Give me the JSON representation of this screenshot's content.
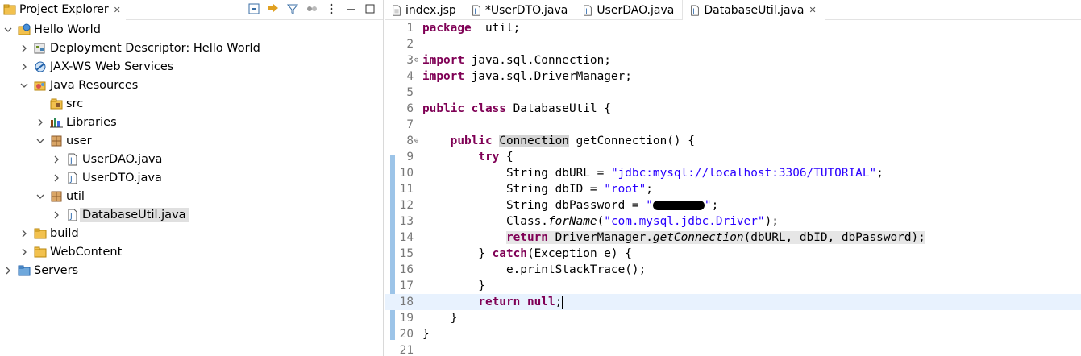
{
  "explorer": {
    "title": "Project Explorer",
    "tree": [
      {
        "label": "Hello World",
        "depth": 0,
        "twisty": "expanded",
        "icon": "web-project-icon"
      },
      {
        "label": "Deployment Descriptor: Hello World",
        "depth": 1,
        "twisty": "collapsed",
        "icon": "deployment-descriptor-icon"
      },
      {
        "label": "JAX-WS Web Services",
        "depth": 1,
        "twisty": "collapsed",
        "icon": "web-services-icon"
      },
      {
        "label": "Java Resources",
        "depth": 1,
        "twisty": "expanded",
        "icon": "java-resources-icon"
      },
      {
        "label": "src",
        "depth": 2,
        "twisty": "none",
        "icon": "source-folder-icon"
      },
      {
        "label": "Libraries",
        "depth": 2,
        "twisty": "collapsed",
        "icon": "libraries-icon"
      },
      {
        "label": "user",
        "depth": 2,
        "twisty": "expanded",
        "icon": "package-icon"
      },
      {
        "label": "UserDAO.java",
        "depth": 3,
        "twisty": "collapsed",
        "icon": "java-file-icon"
      },
      {
        "label": "UserDTO.java",
        "depth": 3,
        "twisty": "collapsed",
        "icon": "java-file-icon"
      },
      {
        "label": "util",
        "depth": 2,
        "twisty": "expanded",
        "icon": "package-icon"
      },
      {
        "label": "DatabaseUtil.java",
        "depth": 3,
        "twisty": "collapsed",
        "icon": "java-file-icon",
        "selected": true
      },
      {
        "label": "build",
        "depth": 1,
        "twisty": "collapsed",
        "icon": "folder-icon"
      },
      {
        "label": "WebContent",
        "depth": 1,
        "twisty": "collapsed",
        "icon": "folder-icon"
      },
      {
        "label": "Servers",
        "depth": 0,
        "twisty": "collapsed",
        "icon": "servers-folder-icon"
      }
    ]
  },
  "editor": {
    "tabs": [
      {
        "label": "index.jsp",
        "icon": "jsp-file-icon",
        "active": false
      },
      {
        "label": "*UserDTO.java",
        "icon": "java-file-icon",
        "active": false
      },
      {
        "label": "UserDAO.java",
        "icon": "java-file-icon",
        "active": false
      },
      {
        "label": "DatabaseUtil.java",
        "icon": "java-file-icon",
        "active": true
      }
    ],
    "lines": [
      {
        "n": "1",
        "tokens": [
          [
            "kw",
            "package"
          ],
          [
            "",
            "  util;"
          ]
        ]
      },
      {
        "n": "2",
        "tokens": []
      },
      {
        "n": "3",
        "fold": true,
        "tokens": [
          [
            "kw",
            "import"
          ],
          [
            "",
            " java.sql.Connection;"
          ]
        ]
      },
      {
        "n": "4",
        "tokens": [
          [
            "kw",
            "import"
          ],
          [
            "",
            " java.sql.DriverManager;"
          ]
        ]
      },
      {
        "n": "5",
        "tokens": []
      },
      {
        "n": "6",
        "tokens": [
          [
            "kw",
            "public"
          ],
          [
            "",
            " "
          ],
          [
            "kw",
            "class"
          ],
          [
            "",
            " DatabaseUtil {"
          ]
        ]
      },
      {
        "n": "7",
        "tokens": []
      },
      {
        "n": "8",
        "fold": true,
        "tokens": [
          [
            "",
            "    "
          ],
          [
            "kw",
            "public"
          ],
          [
            "",
            " "
          ],
          [
            "occ",
            "Connection"
          ],
          [
            "",
            " getConnection() {"
          ]
        ]
      },
      {
        "n": "9",
        "tokens": [
          [
            "",
            "        "
          ],
          [
            "kw",
            "try"
          ],
          [
            "",
            " {"
          ]
        ]
      },
      {
        "n": "10",
        "tokens": [
          [
            "",
            "            String dbURL = "
          ],
          [
            "str",
            "\"jdbc:mysql://localhost:3306/TUTORIAL\""
          ],
          [
            "",
            ";"
          ]
        ]
      },
      {
        "n": "11",
        "tokens": [
          [
            "",
            "            String dbID = "
          ],
          [
            "str",
            "\"root\""
          ],
          [
            "",
            ";"
          ]
        ]
      },
      {
        "n": "12",
        "tokens": [
          [
            "",
            "            String dbPassword = "
          ],
          [
            "str",
            "\""
          ],
          [
            "redact",
            ""
          ],
          [
            "str",
            "\""
          ],
          [
            "",
            ";"
          ]
        ]
      },
      {
        "n": "13",
        "tokens": [
          [
            "",
            "            Class."
          ],
          [
            "it",
            "forName"
          ],
          [
            "",
            "("
          ],
          [
            "str",
            "\"com.mysql.jdbc.Driver\""
          ],
          [
            "",
            ");"
          ]
        ]
      },
      {
        "n": "14",
        "tokens": [
          [
            "",
            "            "
          ],
          [
            "hlstart",
            ""
          ],
          [
            "kw",
            "return"
          ],
          [
            "",
            " DriverManager."
          ],
          [
            "it",
            "getConnection"
          ],
          [
            "",
            "(dbURL, dbID, dbPassword);"
          ],
          [
            "hlend",
            ""
          ]
        ]
      },
      {
        "n": "15",
        "tokens": [
          [
            "",
            "        } "
          ],
          [
            "kw",
            "catch"
          ],
          [
            "",
            "(Exception e) {"
          ]
        ]
      },
      {
        "n": "16",
        "tokens": [
          [
            "",
            "            e.printStackTrace();"
          ]
        ]
      },
      {
        "n": "17",
        "tokens": [
          [
            "",
            "        }"
          ]
        ]
      },
      {
        "n": "18",
        "current": true,
        "tokens": [
          [
            "",
            "        "
          ],
          [
            "kw",
            "return"
          ],
          [
            "",
            " "
          ],
          [
            "kw",
            "null"
          ],
          [
            "",
            ";"
          ],
          [
            "caret",
            ""
          ]
        ]
      },
      {
        "n": "19",
        "tokens": [
          [
            "",
            "    }"
          ]
        ]
      },
      {
        "n": "20",
        "tokens": [
          [
            "",
            "}"
          ]
        ]
      },
      {
        "n": "21",
        "tokens": []
      }
    ]
  }
}
